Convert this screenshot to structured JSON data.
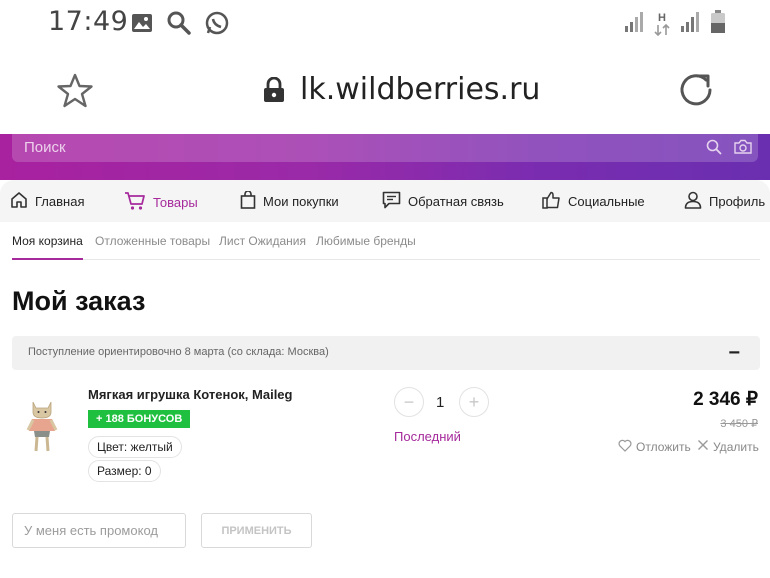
{
  "status_bar": {
    "time": "17:49",
    "network_letter": "H"
  },
  "browser": {
    "url": "lk.wildberries.ru"
  },
  "search": {
    "placeholder": "Поиск"
  },
  "nav": {
    "items": [
      {
        "label": "Главная",
        "icon": "home-icon"
      },
      {
        "label": "Товары",
        "icon": "cart-icon",
        "active": true
      },
      {
        "label": "Мои покупки",
        "icon": "bag-icon"
      },
      {
        "label": "Обратная связь",
        "icon": "feedback-icon"
      },
      {
        "label": "Социальные",
        "icon": "thumbs-up-icon"
      },
      {
        "label": "Профиль",
        "icon": "user-icon"
      }
    ]
  },
  "tabs": [
    {
      "label": "Моя корзина",
      "active": true
    },
    {
      "label": "Отложенные товары"
    },
    {
      "label": "Лист Ожидания"
    },
    {
      "label": "Любимые бренды"
    }
  ],
  "page_title": "Мой заказ",
  "delivery": {
    "text": "Поступление ориентировочно 8 марта (со склада: Москва)",
    "collapse_symbol": "−"
  },
  "product": {
    "name": "Мягкая игрушка Котенок, Maileg",
    "bonus": "+ 188 БОНУСОВ",
    "color": "Цвет: желтый",
    "size": "Размер: 0",
    "quantity": "1",
    "minus": "−",
    "plus": "+",
    "stock_note": "Последний",
    "price": "2 346 ₽",
    "old_price": "3 450 ₽",
    "save_label": "Отложить",
    "delete_label": "Удалить"
  },
  "promo": {
    "placeholder": "У меня есть промокод",
    "apply_label": "ПРИМЕНИТЬ"
  },
  "colors": {
    "accent": "#a62a9c",
    "bonus_green": "#1fbf3f"
  }
}
